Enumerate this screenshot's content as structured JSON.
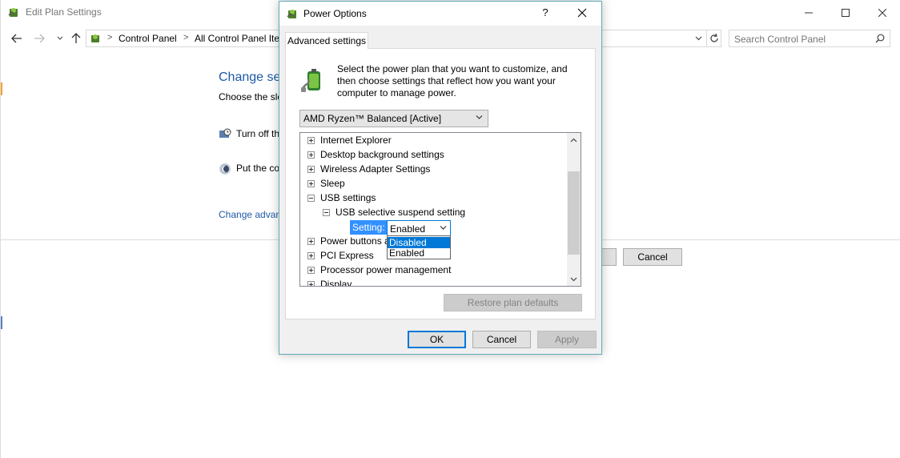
{
  "background_window": {
    "title": "Edit Plan Settings",
    "address": {
      "crumbs": [
        "Control Panel",
        "All Control Panel Ite"
      ],
      "separator": ">"
    },
    "search": {
      "placeholder": "Search Control Panel"
    },
    "heading": "Change set",
    "subtitle": "Choose the sle",
    "rows": [
      {
        "label": "Turn off th",
        "icon": "clock-monitor-icon"
      },
      {
        "label": "Put the co",
        "icon": "moon-icon"
      }
    ],
    "advanced_link": "Change advan",
    "cancel_label": "Cancel"
  },
  "dialog": {
    "title": "Power Options",
    "help_glyph": "?",
    "tab_label": "Advanced settings",
    "intro": "Select the power plan that you want to customize, and then choose settings that reflect how you want your computer to manage power.",
    "plan_selected": "AMD Ryzen™ Balanced [Active]",
    "tree": {
      "items": [
        {
          "label": "Internet Explorer",
          "expander": "plus",
          "level": 0
        },
        {
          "label": "Desktop background settings",
          "expander": "plus",
          "level": 0
        },
        {
          "label": "Wireless Adapter Settings",
          "expander": "plus",
          "level": 0
        },
        {
          "label": "Sleep",
          "expander": "plus",
          "level": 0
        },
        {
          "label": "USB settings",
          "expander": "minus",
          "level": 0
        },
        {
          "label": "USB selective suspend setting",
          "expander": "minus",
          "level": 1
        },
        {
          "label": "Power buttons a",
          "expander": "plus",
          "level": 0
        },
        {
          "label": "PCI Express",
          "expander": "plus",
          "level": 0
        },
        {
          "label": "Processor power management",
          "expander": "plus",
          "level": 0
        },
        {
          "label": "Display",
          "expander": "plus",
          "level": 0
        }
      ],
      "setting_label": "Setting:",
      "setting_value": "Enabled",
      "dropdown_options": [
        "Disabled",
        "Enabled"
      ],
      "dropdown_highlighted": "Disabled"
    },
    "restore_label": "Restore plan defaults",
    "buttons": {
      "ok": "OK",
      "cancel": "Cancel",
      "apply": "Apply"
    }
  },
  "colors": {
    "accent": "#0078d7",
    "link": "#1e5aa8",
    "highlight": "#3390ff"
  }
}
